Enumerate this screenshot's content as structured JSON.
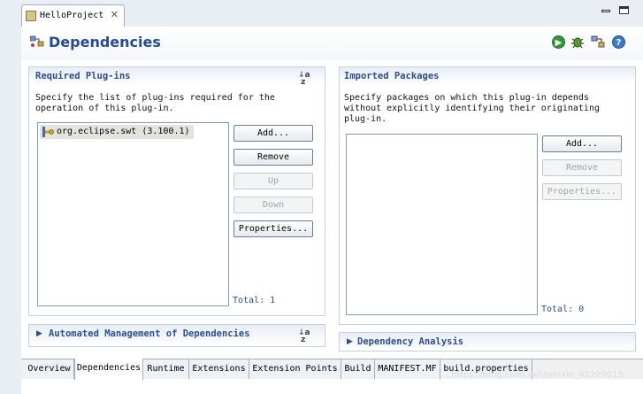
{
  "editor": {
    "tab_title": "HelloProject"
  },
  "header": {
    "title": "Dependencies"
  },
  "required": {
    "title": "Required Plug-ins",
    "description_line1": "Specify the list of plug-ins required for the",
    "description_line2": "operation of this plug-in.",
    "items": [
      {
        "name": "org.eclipse.swt (3.100.1)"
      }
    ],
    "buttons": {
      "add": "Add...",
      "remove": "Remove",
      "up": "Up",
      "down": "Down",
      "properties": "Properties..."
    },
    "total": "Total: 1"
  },
  "imported": {
    "title": "Imported Packages",
    "description_line1": "Specify packages on which this plug-in depends",
    "description_line2": "without explicitly identifying their originating",
    "description_line3": "plug-in.",
    "buttons": {
      "add": "Add...",
      "remove": "Remove",
      "properties": "Properties..."
    },
    "total": "Total: 0"
  },
  "automated": {
    "title": "Automated Management of Dependencies"
  },
  "analysis": {
    "title": "Dependency Analysis"
  },
  "bottom_tabs": {
    "overview": "Overview",
    "dependencies": "Dependencies",
    "runtime": "Runtime",
    "extensions": "Extensions",
    "extension_points": "Extension Points",
    "build": "Build",
    "manifest": "MANIFEST.MF",
    "build_properties": "build.properties"
  },
  "watermark": "https://blog.csdn.net/weixin_41299015",
  "colors": {
    "accent": "#274b8c",
    "section_title": "#2a4e8e",
    "border": "#c4d0dd"
  }
}
